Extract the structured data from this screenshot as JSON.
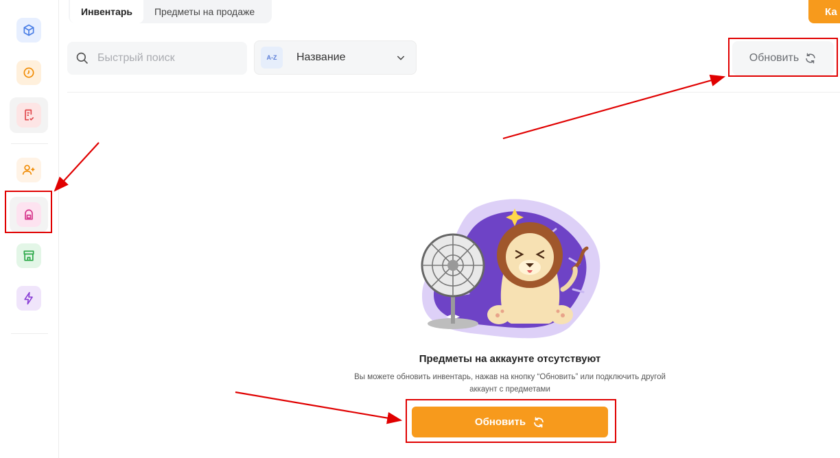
{
  "tabs": [
    {
      "label": "Инвентарь",
      "active": true
    },
    {
      "label": "Предметы на продаже",
      "active": false
    }
  ],
  "top_button": {
    "label": "Ка"
  },
  "search": {
    "placeholder": "Быстрый поиск",
    "value": ""
  },
  "sort": {
    "badge": "A-Z",
    "label": "Название"
  },
  "refresh_top": {
    "label": "Обновить"
  },
  "empty_state": {
    "title": "Предметы на аккаунте отсутствуют",
    "description_line1": "Вы можете обновить инвентарь, нажав на кнопку “Обновить” или подключить другой",
    "description_line2": "аккаунт с предметами",
    "button_label": "Обновить"
  },
  "sidebar": {
    "items": [
      {
        "icon": "cube-icon",
        "color": "#4a7ee6",
        "bg": "#e7efff"
      },
      {
        "icon": "clock-icon",
        "color": "#f08a00",
        "bg": "#fff0dc"
      },
      {
        "icon": "checklist-icon",
        "color": "#e0464a",
        "bg": "#fde5e5"
      },
      {
        "icon": "user-plus-icon",
        "color": "#f08a00",
        "bg": "#fff3e6"
      },
      {
        "icon": "backpack-icon",
        "color": "#d6338a",
        "bg": "#fde3f0"
      },
      {
        "icon": "store-icon",
        "color": "#28a745",
        "bg": "#e3f6e7"
      },
      {
        "icon": "lightning-icon",
        "color": "#8a3fd6",
        "bg": "#f0e5fb"
      }
    ]
  },
  "colors": {
    "accent": "#f79a1c",
    "annotation": "#e00000"
  }
}
